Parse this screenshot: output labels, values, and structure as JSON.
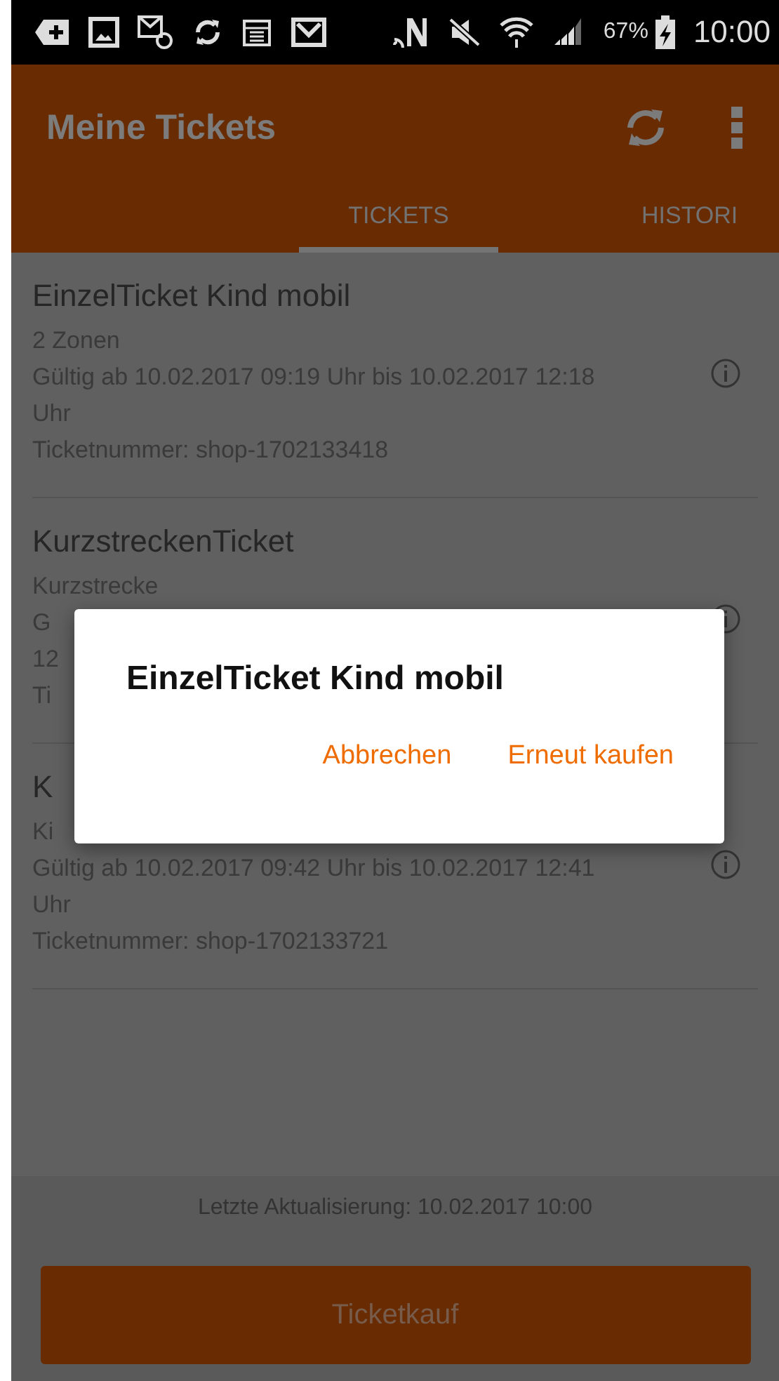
{
  "status_bar": {
    "battery": "67%",
    "time": "10:00"
  },
  "app_bar": {
    "title": "Meine Tickets"
  },
  "tabs": [
    {
      "label": "TICKETS",
      "selected": true
    },
    {
      "label": "HISTORI",
      "selected": false
    }
  ],
  "tickets": [
    {
      "title": "EinzelTicket Kind mobil",
      "details": [
        "2 Zonen",
        "Gültig ab 10.02.2017 09:19 Uhr bis 10.02.2017 12:18 Uhr",
        "Ticketnummer: shop-1702133418"
      ]
    },
    {
      "title": "KurzstreckenTicket",
      "details": [
        "Kurzstrecke",
        "G",
        "12",
        "Ti"
      ]
    },
    {
      "title": "K",
      "details": [
        "Ki",
        "Gültig ab 10.02.2017 09:42 Uhr bis 10.02.2017 12:41 Uhr",
        "Ticketnummer: shop-1702133721"
      ]
    }
  ],
  "last_update": "Letzte Aktualisierung: 10.02.2017 10:00",
  "buy_button": "Ticketkauf",
  "dialog": {
    "title": "EinzelTicket Kind mobil",
    "buttons": [
      "Abbrechen",
      "Erneut kaufen"
    ]
  }
}
